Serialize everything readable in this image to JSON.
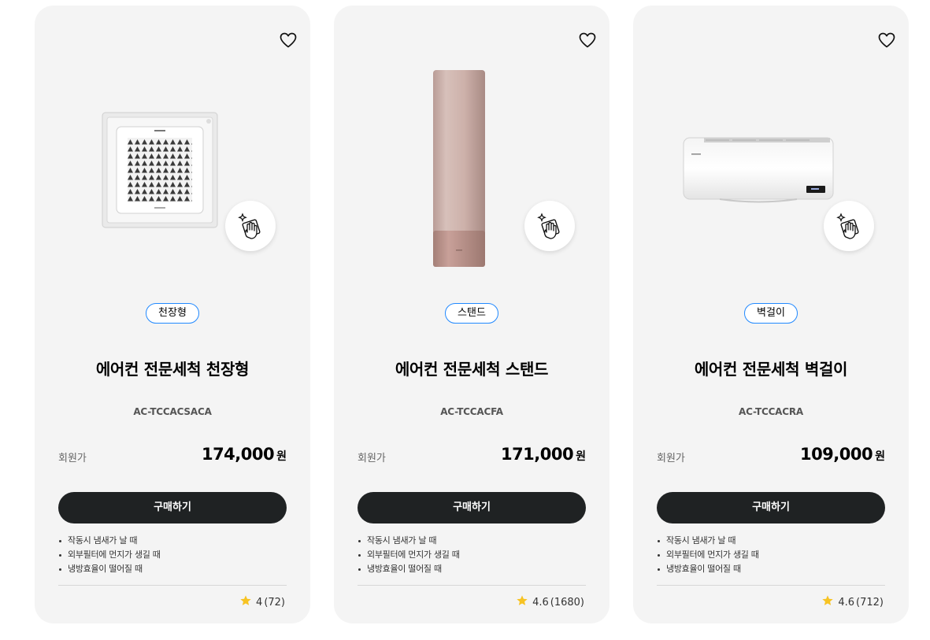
{
  "cards": [
    {
      "image": "ceiling-cassette-ac",
      "service_icon": "cleaning-hand-icon",
      "type_tag": "천장형",
      "title": "에어컨 전문세척 천장형",
      "model": "AC-TCCACSACA",
      "price_label": "회원가",
      "price": "174,000",
      "currency": "원",
      "buy_label": "구매하기",
      "features": [
        "작동시 냄새가 날 때",
        "외부필터에 먼지가 생길 때",
        "냉방효율이 떨어질 때"
      ],
      "rating": "4",
      "review_count": "(72)"
    },
    {
      "image": "standing-ac",
      "service_icon": "cleaning-hand-icon",
      "type_tag": "스탠드",
      "title": "에어컨 전문세척 스탠드",
      "model": "AC-TCCACFA",
      "price_label": "회원가",
      "price": "171,000",
      "currency": "원",
      "buy_label": "구매하기",
      "features": [
        "작동시 냄새가 날 때",
        "외부필터에 먼지가 생길 때",
        "냉방효율이 떨어질 때"
      ],
      "rating": "4.6",
      "review_count": "(1680)"
    },
    {
      "image": "wall-mounted-ac",
      "service_icon": "cleaning-hand-icon",
      "type_tag": "벽걸이",
      "title": "에어컨 전문세척 벽걸이",
      "model": "AC-TCCACRA",
      "price_label": "회원가",
      "price": "109,000",
      "currency": "원",
      "buy_label": "구매하기",
      "features": [
        "작동시 냄새가 날 때",
        "외부필터에 먼지가 생길 때",
        "냉방효율이 떨어질 때"
      ],
      "rating": "4.6",
      "review_count": "(712)"
    }
  ],
  "colors": {
    "card_bg": "#f4f4f4",
    "tag_border": "#2189ff",
    "button_bg": "#1f2223",
    "star": "#f7c323"
  }
}
